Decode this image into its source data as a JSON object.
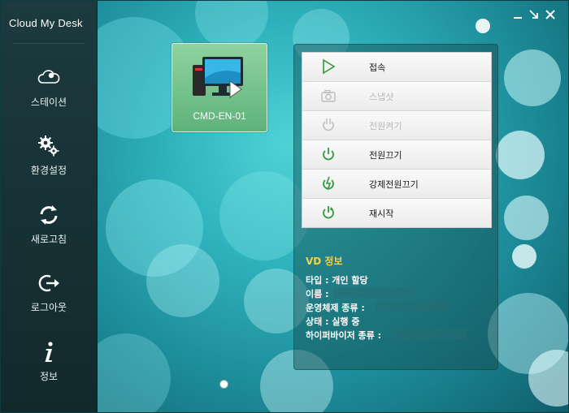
{
  "app": {
    "brand": "Cloud My Desk"
  },
  "sidebar": {
    "items": [
      {
        "label": "스테이션",
        "icon": "cloud-station-icon"
      },
      {
        "label": "환경설정",
        "icon": "gear-icon"
      },
      {
        "label": "새로고침",
        "icon": "refresh-icon"
      },
      {
        "label": "로그아웃",
        "icon": "logout-icon"
      },
      {
        "label": "정보",
        "icon": "info-icon"
      }
    ]
  },
  "vm": {
    "name": "CMD-EN-01"
  },
  "menu": {
    "items": [
      {
        "label": "접속",
        "enabled": true,
        "icon": "play-icon"
      },
      {
        "label": "스냅샷",
        "enabled": false,
        "icon": "camera-icon"
      },
      {
        "label": "전원켜기",
        "enabled": false,
        "icon": "power-on-icon"
      },
      {
        "label": "전원끄기",
        "enabled": true,
        "icon": "power-off-icon"
      },
      {
        "label": "강제전원끄기",
        "enabled": true,
        "icon": "force-power-off-icon"
      },
      {
        "label": "재시작",
        "enabled": true,
        "icon": "restart-icon"
      }
    ]
  },
  "info": {
    "title": "VD 정보",
    "type": "타입 : 개인 할당",
    "name": "이름 :",
    "os": "운영체제 종류 :",
    "status": "상태 : 실행 중",
    "hypervisor": "하이퍼바이저 종류 :"
  },
  "colors": {
    "accent_green": "#2e9a3e",
    "info_title": "#f2d24a"
  }
}
